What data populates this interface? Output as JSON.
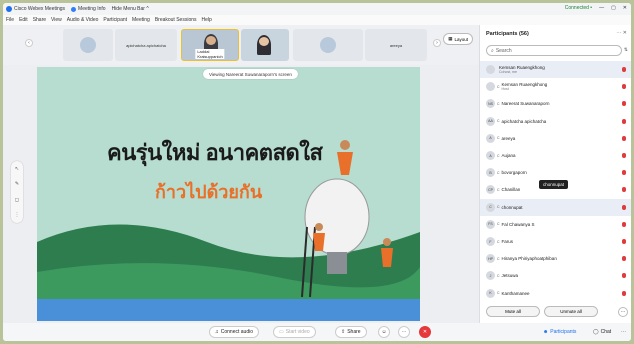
{
  "window": {
    "app_title": "Cisco Webex Meetings",
    "meeting_info": "Meeting Info",
    "hide_menu_bar": "Hide Menu Bar ^",
    "connected": "Connected •"
  },
  "menu": [
    "File",
    "Edit",
    "Share",
    "View",
    "Audio & Video",
    "Participant",
    "Meeting",
    "Breakout Sessions",
    "Help"
  ],
  "thumbnails": {
    "left_name": "apichatcha apichatcha",
    "active_label": "Laddal Kraisuppanich",
    "right_name": "areeya",
    "layout_label": "Layout"
  },
  "share": {
    "viewing_banner": "Viewing Nareerat Suwanaraporn's screen",
    "slide_line1": "คนรุ่นใหม่ อนาคตสดใส",
    "slide_line2": "ก้าวไปด้วยกัน"
  },
  "tooltip": "chonnupat",
  "controls": {
    "connect_audio": "Connect audio",
    "start_video": "Start video",
    "share": "Share",
    "participants": "Participants",
    "chat": "Chat"
  },
  "panel": {
    "title": "Participants (56)",
    "search_placeholder": "Search",
    "participants": [
      {
        "initials": "",
        "role": "",
        "name": "Kemsan Ruaengkhong",
        "sub": "Cohost, me",
        "selected": true
      },
      {
        "initials": "",
        "role": "C",
        "name": "Kemsan Ruaengkhong",
        "sub": "Host",
        "selected": false
      },
      {
        "initials": "NS",
        "role": "C",
        "name": "Nareerat Suwanaraporn",
        "sub": "",
        "selected": false
      },
      {
        "initials": "AA",
        "role": "C",
        "name": "apichatcha apichatcha",
        "sub": "",
        "selected": false
      },
      {
        "initials": "A",
        "role": "C",
        "name": "areeya",
        "sub": "",
        "selected": false
      },
      {
        "initials": "A",
        "role": "C",
        "name": "Aujana",
        "sub": "",
        "selected": false
      },
      {
        "initials": "B",
        "role": "C",
        "name": "bovorgaporn",
        "sub": "",
        "selected": false
      },
      {
        "initials": "CP",
        "role": "C",
        "name": "Chanillan",
        "sub": "",
        "selected": false
      },
      {
        "initials": "C",
        "role": "C",
        "name": "chonnupat",
        "sub": "",
        "selected": true
      },
      {
        "initials": "FS",
        "role": "C",
        "name": "Fal Chawanya S",
        "sub": "",
        "selected": false
      },
      {
        "initials": "F",
        "role": "C",
        "name": "Farus",
        "sub": "",
        "selected": false
      },
      {
        "initials": "HP",
        "role": "C",
        "name": "Hiranya Phiriyaphoatphiban",
        "sub": "",
        "selected": false
      },
      {
        "initials": "J",
        "role": "C",
        "name": "Jetsuwa",
        "sub": "",
        "selected": false
      },
      {
        "initials": "K",
        "role": "C",
        "name": "Kanthamanee",
        "sub": "",
        "selected": false
      }
    ],
    "mute_all": "Mute all",
    "unmute_all": "Unmute all"
  },
  "colors": {
    "accent": "#1f6feb",
    "end_call": "#e5393b",
    "mic_muted": "#e03b3b",
    "slide_bg": "#b6ddd0",
    "slide_title_orange": "#e8702a"
  }
}
